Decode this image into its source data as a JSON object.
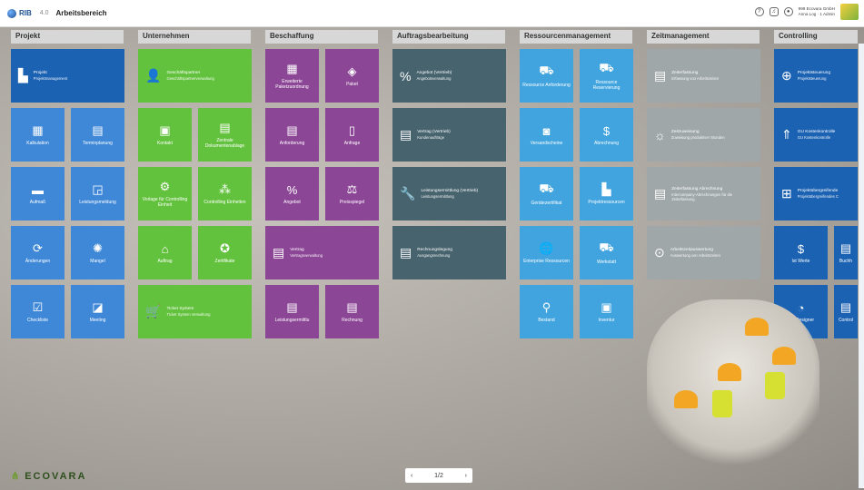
{
  "header": {
    "logo": "RIB",
    "version": "4.0",
    "workspace": "Arbeitsbereich",
    "account_line1": "999 Ecovara GmbH",
    "account_line2": "Anna Log · 1 Admin",
    "icons": [
      "help-icon",
      "bell-icon",
      "user-icon"
    ]
  },
  "columns": [
    {
      "title": "Projekt"
    },
    {
      "title": "Unternehmen"
    },
    {
      "title": "Beschaffung"
    },
    {
      "title": "Auftragsbearbeitung"
    },
    {
      "title": "Ressourcenmanagement"
    },
    {
      "title": "Zeitmanagement"
    },
    {
      "title": "Controlling"
    }
  ],
  "tiles": {
    "projekt": [
      {
        "title": "Projekt",
        "subtitle": "Projektmanagement",
        "icon": "building-icon"
      },
      {
        "title": "Kalkulation",
        "icon": "calculator-icon"
      },
      {
        "title": "Terminplanung",
        "icon": "calendar-icon"
      },
      {
        "title": "Aufmaß",
        "icon": "ruler-icon"
      },
      {
        "title": "Leistungsmeldung",
        "icon": "report-icon"
      },
      {
        "title": "Änderungen",
        "icon": "change-icon"
      },
      {
        "title": "Mangel",
        "icon": "defect-icon"
      },
      {
        "title": "Checkliste",
        "icon": "checklist-icon"
      },
      {
        "title": "Meeting",
        "icon": "meeting-icon"
      }
    ],
    "unternehmen": [
      {
        "title": "Geschäftspartner",
        "subtitle": "Geschäftspartnerverwaltung",
        "icon": "partner-icon"
      },
      {
        "title": "Kontakt",
        "icon": "contact-icon"
      },
      {
        "title": "Zentrale Dokumentenablage",
        "icon": "document-icon"
      },
      {
        "title": "Vorlage für Controlling Einheit",
        "icon": "template-icon"
      },
      {
        "title": "Controlling Einheiten",
        "icon": "units-icon"
      },
      {
        "title": "Auftrag",
        "icon": "order-icon"
      },
      {
        "title": "Zertifikate",
        "icon": "certificate-icon"
      },
      {
        "title": "Ticket System",
        "subtitle": "Ticket System Verwaltung",
        "icon": "ticket-icon"
      }
    ],
    "beschaffung": [
      {
        "title": "Erweiterte Paketzuordnung",
        "icon": "package-assign-icon"
      },
      {
        "title": "Paket",
        "icon": "package-icon"
      },
      {
        "title": "Anforderung",
        "icon": "request-icon"
      },
      {
        "title": "Anfrage",
        "icon": "inquiry-icon"
      },
      {
        "title": "Angebot",
        "icon": "offer-icon"
      },
      {
        "title": "Preisspiegel",
        "icon": "price-scale-icon"
      },
      {
        "title": "Vertrag",
        "subtitle": "Vertragsverwaltung",
        "icon": "contract-icon"
      },
      {
        "title": "Leistungsermittlu",
        "icon": "performance-icon"
      },
      {
        "title": "Rechnung",
        "icon": "invoice-icon"
      }
    ],
    "auftrag": [
      {
        "title": "Angebot (Vertrieb)",
        "subtitle": "Angebotsverwaltung",
        "icon": "offer-icon"
      },
      {
        "title": "Vertrag (Vertrieb)",
        "subtitle": "Kundenaufträge",
        "icon": "contract-icon"
      },
      {
        "title": "Leistungsermittlung (Vertrieb)",
        "subtitle": "Leistungsermittlung",
        "icon": "wrench-icon"
      },
      {
        "title": "Rechnungslegung",
        "subtitle": "Ausgangsrechnung",
        "icon": "invoice-icon"
      }
    ],
    "ressourcen": [
      {
        "title": "Ressource Anforderung",
        "icon": "resource-request-icon"
      },
      {
        "title": "Ressource Reservierung",
        "icon": "resource-reserve-icon"
      },
      {
        "title": "Versandscheine",
        "icon": "shipping-icon"
      },
      {
        "title": "Abrechnung",
        "icon": "billing-icon"
      },
      {
        "title": "Gerätezertifikat",
        "icon": "device-cert-icon"
      },
      {
        "title": "Projektressourcen",
        "icon": "project-resource-icon"
      },
      {
        "title": "Enterprise Ressourcen",
        "icon": "enterprise-icon"
      },
      {
        "title": "Werkstatt",
        "icon": "workshop-icon"
      },
      {
        "title": "Bestand",
        "icon": "stock-icon"
      },
      {
        "title": "Inventur",
        "icon": "inventory-icon"
      }
    ],
    "zeit": [
      {
        "title": "Zeiterfassung",
        "subtitle": "Erfassung von Arbeitszeiten",
        "icon": "time-entry-icon"
      },
      {
        "title": "Zeitzuweisung",
        "subtitle": "Zuweisung produktiver Stunden",
        "icon": "sun-icon"
      },
      {
        "title": "Zeiterfassung Abrechnung",
        "subtitle": "Intercompany-Abrechnungen für die Zeiterfassung",
        "icon": "time-billing-icon"
      },
      {
        "title": "Arbeitszeitauswertung",
        "subtitle": "Auswertung von Arbeitszeiten",
        "icon": "search-icon"
      }
    ],
    "controlling": [
      {
        "title": "Projektsteuerung",
        "subtitle": "Projektsteuerung",
        "icon": "chart-search-icon"
      },
      {
        "title": "GU Kostenkontrolle",
        "subtitle": "GU Kostenkontrolle",
        "icon": "cost-control-icon"
      },
      {
        "title": "Projektübergreifende",
        "subtitle": "Projektübergreifendes C",
        "icon": "cross-project-icon"
      },
      {
        "title": "Ist Werte",
        "icon": "actual-values-icon"
      },
      {
        "title": "Buchh",
        "icon": "accounting-icon"
      },
      {
        "title": "BI+ Designer",
        "icon": "bi-designer-icon"
      },
      {
        "title": "Control",
        "icon": "control-icon"
      }
    ]
  },
  "pager": {
    "prev": "‹",
    "label": "1/2",
    "next": "›"
  },
  "footer": {
    "brand": "ECOVARA"
  }
}
